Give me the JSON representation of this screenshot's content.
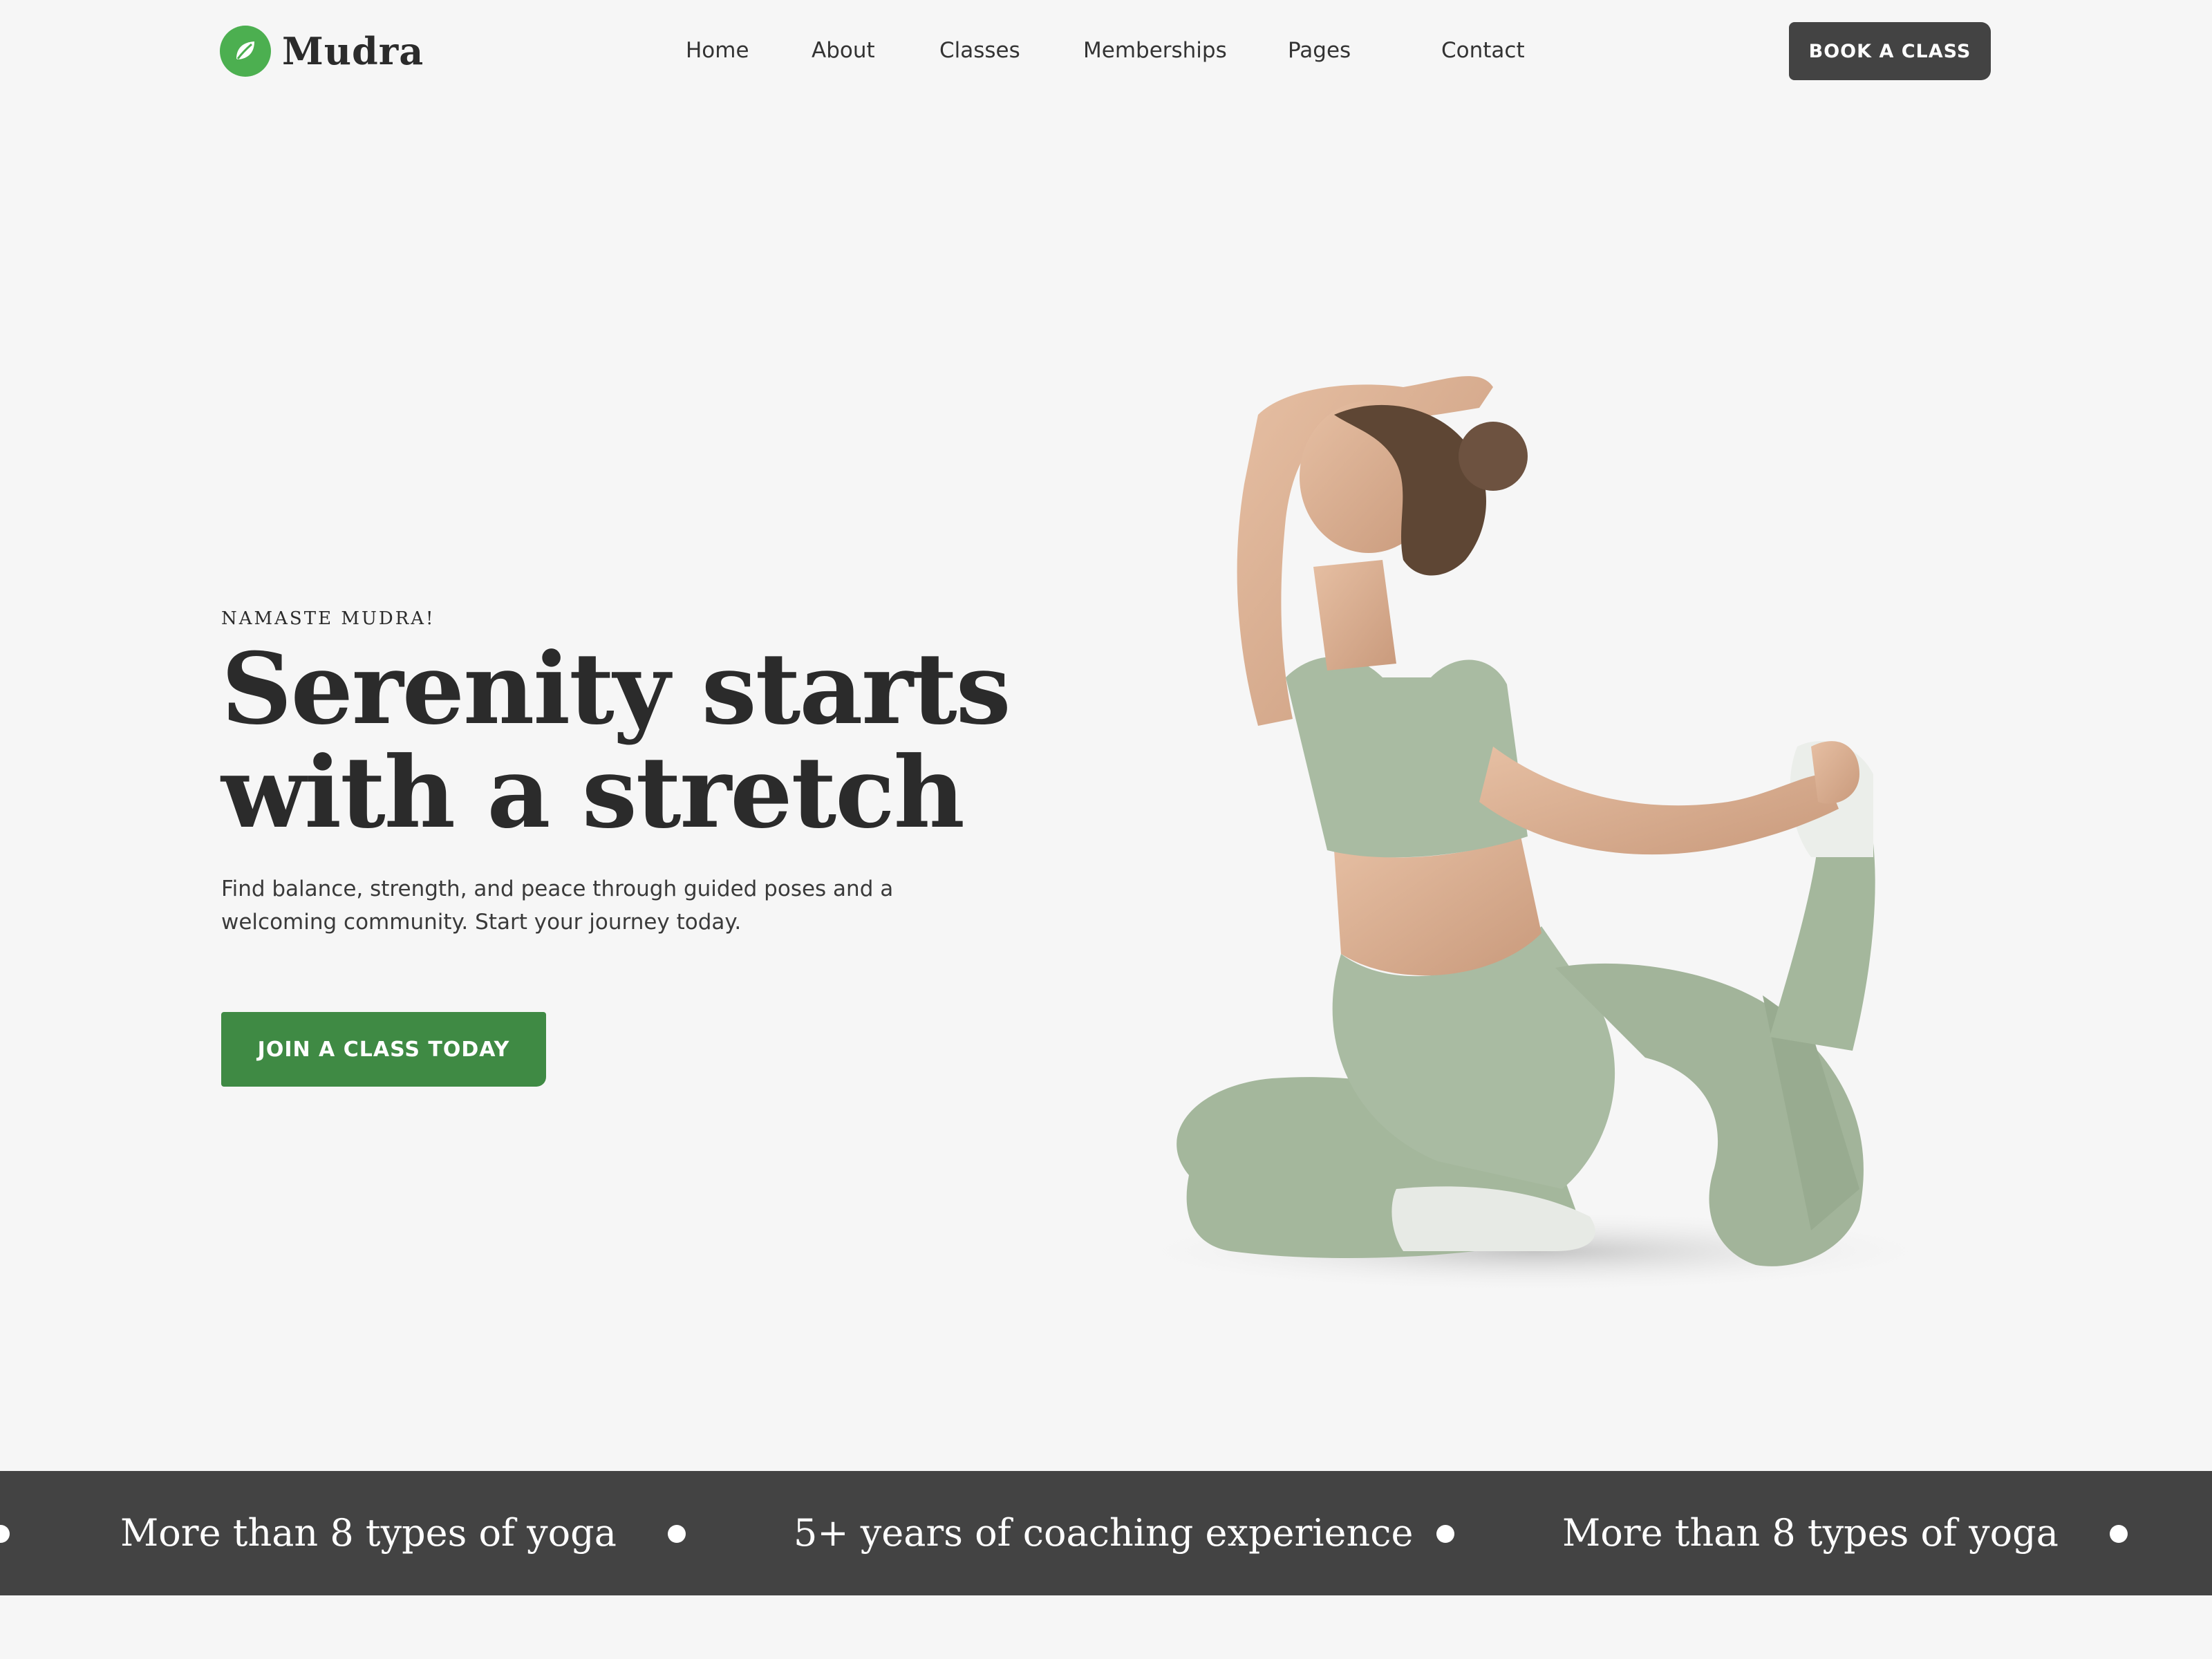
{
  "brand": {
    "name": "Mudra",
    "logo_icon": "leaf-icon",
    "accent_color": "#4caf50"
  },
  "nav": {
    "items": [
      "Home",
      "About",
      "Classes",
      "Memberships",
      "Pages",
      "Contact"
    ]
  },
  "header": {
    "book_label": "BOOK A CLASS"
  },
  "hero": {
    "eyebrow": "NAMASTE MUDRA!",
    "headline_line1": "Serenity starts",
    "headline_line2": "with a stretch",
    "subtext_line1": "Find balance, strength, and peace through guided poses and a",
    "subtext_line2": "welcoming community. Start your journey today.",
    "cta_label": "JOIN A CLASS TODAY",
    "cta_color": "#3f8a44",
    "image_subject": "woman-yoga-pose"
  },
  "marquee": {
    "items": [
      "More than 8 types of yoga",
      "5+ years of coaching experience",
      "More than 8 types of yoga"
    ],
    "background": "#434343"
  }
}
